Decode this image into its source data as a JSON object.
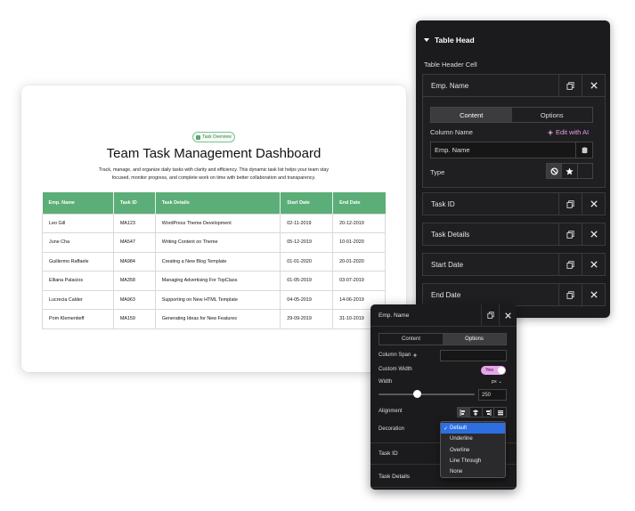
{
  "dashboard": {
    "pill": "Task Overview",
    "title": "Team Task Management Dashboard",
    "subtitle": "Track, manage, and organize daily tasks with clarity and efficiency. This dynamic task list helps your team stay focused, monitor progress, and complete work on time with better collaboration and transparency.",
    "columns": [
      "Emp. Name",
      "Task ID",
      "Task Details",
      "Start Date",
      "End Date"
    ],
    "rows": [
      [
        "Leo Gill",
        "MA123",
        "WordPress Theme Development",
        "02-11-2019",
        "20-12-2019"
      ],
      [
        "June Cha",
        "MA547",
        "Writing Content on Theme",
        "05-12-2019",
        "10-01-2020"
      ],
      [
        "Guillermo Raffaele",
        "MA984",
        "Creating a New Blog Template",
        "01-01-2020",
        "20-01-2020"
      ],
      [
        "Elliana Palacios",
        "MA358",
        "Managing Advertising For TopClass",
        "01-05-2019",
        "03-07-2019"
      ],
      [
        "Lucrecia Calder",
        "MA963",
        "Supporting on New HTML Template",
        "04-05-2019",
        "14-06-2019"
      ],
      [
        "Pom Klementieff",
        "MA159",
        "Generating Ideas for New Features",
        "29-09-2019",
        "31-10-2019"
      ]
    ],
    "accent_color": "#5cae78"
  },
  "panel1": {
    "section_title": "Table Head",
    "subsection": "Table Header Cell",
    "expanded_item": "Emp. Name",
    "tabs": [
      "Content",
      "Options"
    ],
    "active_tab": "Content",
    "column_name_label": "Column Name",
    "ai_label": "Edit with AI",
    "column_name_value": "Emp. Name",
    "type_label": "Type",
    "items": [
      "Task ID",
      "Task Details",
      "Start Date",
      "End Date"
    ]
  },
  "panel2": {
    "header": "Emp. Name",
    "tabs": [
      "Content",
      "Options"
    ],
    "active_tab": "Options",
    "column_span_label": "Column Span",
    "custom_width_label": "Custom Width",
    "custom_width_value": "Yes",
    "width_label": "Width",
    "width_unit": "px",
    "width_value": "250",
    "width_slider_fraction": 0.4,
    "alignment_label": "Alignment",
    "decoration_label": "Decoration",
    "decoration_options": [
      "Default",
      "Underline",
      "Overline",
      "Line Through",
      "None"
    ],
    "decoration_selected": "Default",
    "items": [
      "Task ID",
      "Task Details"
    ]
  },
  "icons": {
    "duplicate": "copy-icon",
    "remove": "close-icon",
    "ai": "sparkle-icon",
    "dynamic": "database-icon",
    "none": "ban-icon",
    "icon_type": "star-icon"
  }
}
